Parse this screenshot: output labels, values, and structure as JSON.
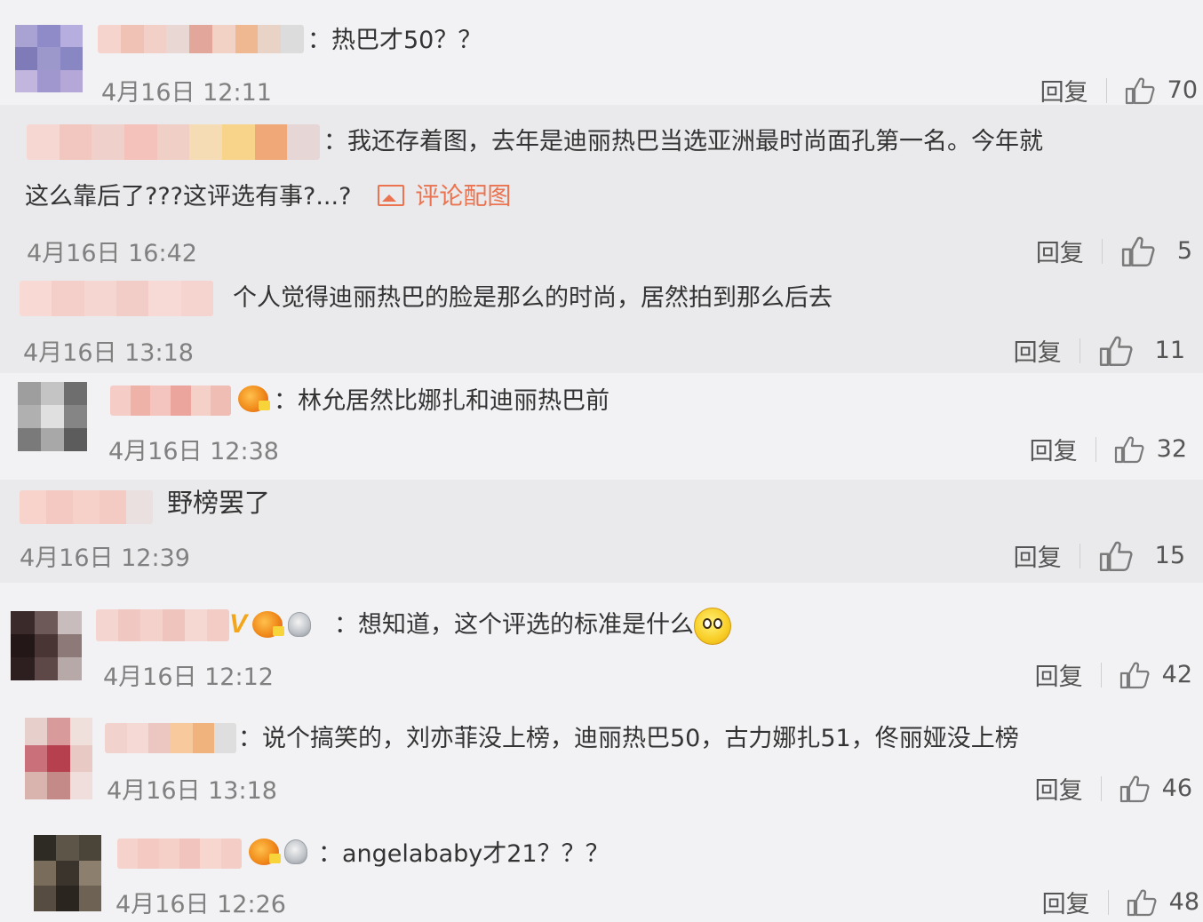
{
  "reply_label": "回复",
  "attach_label": "评论配图",
  "colon": "：",
  "comments": [
    {
      "text": "热巴才50？？",
      "time": "4月16日 12:11",
      "likes": "70",
      "avatar_colors": [
        "#a9a3d4",
        "#8f8ac8",
        "#b7aee0",
        "#7e7bb8",
        "#9d98cc",
        "#8986c4",
        "#c3b6de",
        "#a197cf",
        "#b5a8d8"
      ],
      "name_colors": [
        "#f4d4cc",
        "#f0c2b6",
        "#f2d0c8",
        "#e9d7d3",
        "#e2a79a",
        "#f1d2c5",
        "#f0b891",
        "#e9d3c7",
        "#dcdcdc"
      ],
      "badges": []
    },
    {
      "text": "我还存着图，去年是迪丽热巴当选亚洲最时尚面孔第一名。今年就",
      "text2": "这么靠后了???这评选有事?...?",
      "has_attach": true,
      "time": "4月16日 16:42",
      "likes": "5",
      "name_colors": [
        "#f6d7d2",
        "#f2c7c0",
        "#efd0cb",
        "#f5c2bb",
        "#f0cfc6",
        "#f5dcb5",
        "#f8d38a",
        "#f1a879",
        "#e6d6d6"
      ],
      "badges": []
    },
    {
      "text": "个人觉得迪丽热巴的脸是那么的时尚，居然拍到那么后去",
      "time": "4月16日 13:18",
      "likes": "11",
      "name_colors": [
        "#f8d9d4",
        "#f4cfc9",
        "#f6d6d1",
        "#f2cdc8",
        "#f7dad5",
        "#f5d3ce"
      ],
      "badges": []
    },
    {
      "text": "林允居然比娜扎和迪丽热巴前",
      "time": "4月16日 12:38",
      "likes": "32",
      "avatar_colors": [
        "#9e9e9e",
        "#c4c4c4",
        "#6e6e6e",
        "#b0b0b0",
        "#e0e0e0",
        "#858585",
        "#7a7a7a",
        "#a8a8a8",
        "#5c5c5c"
      ],
      "name_colors": [
        "#f6cdc6",
        "#eeb2a9",
        "#f3c5be",
        "#eba59d",
        "#f5d0c9",
        "#f0bdb5"
      ],
      "badges": [
        "crown"
      ]
    },
    {
      "text": "野榜罢了",
      "time": "4月16日 12:39",
      "likes": "15",
      "name_colors": [
        "#f7d3cc",
        "#f4c9c1",
        "#f6d1ca",
        "#f3cbc3",
        "#e9e0df"
      ],
      "badges": []
    },
    {
      "text": "想知道，这个评选的标准是什么",
      "has_emoji": true,
      "time": "4月16日 12:12",
      "likes": "42",
      "avatar_colors": [
        "#3b2a2a",
        "#6d5a58",
        "#c9bcbc",
        "#241717",
        "#4a3535",
        "#8d7a78",
        "#2d1f20",
        "#5d4847",
        "#b7a9a8"
      ],
      "name_colors": [
        "#f5d5cf",
        "#f1c8c1",
        "#f4d1ca",
        "#efc4bd",
        "#f6d8d2",
        "#f2ccc5"
      ],
      "badges": [
        "v",
        "crown",
        "vip"
      ]
    },
    {
      "text": "说个搞笑的，刘亦菲没上榜，迪丽热巴50，古力娜扎51，佟丽娅没上榜",
      "time": "4月16日 13:18",
      "likes": "46",
      "avatar_colors": [
        "#e7cfcc",
        "#d89a9a",
        "#f0e0dc",
        "#c9707a",
        "#b6404e",
        "#e8c9c4",
        "#d9b3ae",
        "#c48a88",
        "#efdedb"
      ],
      "name_colors": [
        "#f1d2cd",
        "#f4d9d4",
        "#ecc7c1",
        "#f7c99c",
        "#f0b37d",
        "#dedede"
      ],
      "badges": []
    },
    {
      "text": "angelababy才21？？？",
      "time": "4月16日 12:26",
      "likes": "48",
      "avatar_colors": [
        "#2e2a24",
        "#5e5549",
        "#4a4439",
        "#7a6c5b",
        "#3b342c",
        "#8c7f6e",
        "#564c41",
        "#2a251f",
        "#6d6254"
      ],
      "name_colors": [
        "#f6d2cc",
        "#f3c9c2",
        "#f5d0c9",
        "#f1c4bd",
        "#f7d6d0",
        "#f4cdc6"
      ],
      "badges": [
        "crown",
        "vip"
      ]
    }
  ]
}
